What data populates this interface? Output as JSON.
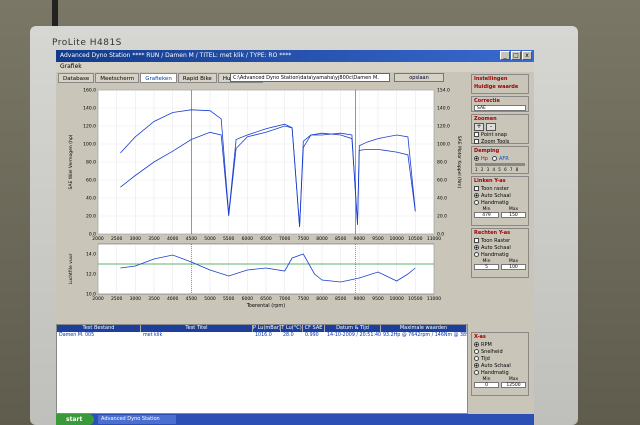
{
  "monitor": {
    "brand": "ProLite H481S"
  },
  "window": {
    "title": "Advanced Dyno Station  **** RUN / Damen M / TITEL: met klik / TYPE: RO ****",
    "btn_min": "_",
    "btn_max": "□",
    "btn_close": "x"
  },
  "menu": {
    "item": "Grafiek"
  },
  "tabs": [
    "Database",
    "Meetscherm",
    "Grafieken",
    "Rapid Bike",
    "Huidige map"
  ],
  "active_tab": "Grafieken",
  "path": "C:\\Advanced Dyno Station\\data\\yamaha\\yj800c\\Damen M.",
  "save_label": "opslaan",
  "top_chart": {
    "ylabel_left": "SAE Wiel Vermogen (hp)",
    "ylabel_right": "SAE Motor Koppel (Nm)",
    "y_left_ticks": [
      "0.0",
      "20.0",
      "40.0",
      "60.0",
      "80.0",
      "100.0",
      "120.0",
      "140.0",
      "160.0"
    ],
    "y_right_ticks": [
      "0.0",
      "20.0",
      "40.0",
      "60.0",
      "80.0",
      "100.0",
      "120.0",
      "140.0",
      "154.0"
    ],
    "x_ticks": [
      "2000",
      "2500",
      "3000",
      "3500",
      "4000",
      "4500",
      "5000",
      "5500",
      "6000",
      "6500",
      "7000",
      "7500",
      "8000",
      "8500",
      "9000",
      "9500",
      "10000",
      "10500",
      "11000"
    ],
    "xlim": [
      2000,
      11000
    ]
  },
  "bottom_chart": {
    "ylabel": "Luchtfile vuur",
    "xlabel": "Toerental (rpm)",
    "y_ticks": [
      "10.0",
      "12.0",
      "14.0"
    ],
    "x_ticks": [
      "2000",
      "2500",
      "3000",
      "3500",
      "4000",
      "4500",
      "5000",
      "5500",
      "6000",
      "6500",
      "7000",
      "7500",
      "8000",
      "8500",
      "9000",
      "9500",
      "10000",
      "10500",
      "11000"
    ],
    "reference_line": 13.0
  },
  "chart_data": [
    {
      "type": "line",
      "title": "",
      "xlabel": "",
      "ylabel": "SAE Wiel Vermogen (hp)",
      "xlim": [
        2000,
        11000
      ],
      "ylim": [
        0,
        160
      ],
      "series": [
        {
          "name": "power",
          "x": [
            2600,
            3000,
            3500,
            4000,
            4500,
            5000,
            5300,
            5500,
            5700,
            6000,
            6500,
            7000,
            7200,
            7400,
            7500,
            7700,
            8000,
            8500,
            8800,
            8950,
            9000,
            9200,
            9500,
            10000,
            10300,
            10500
          ],
          "y": [
            52,
            65,
            80,
            92,
            105,
            113,
            110,
            20,
            95,
            108,
            113,
            120,
            118,
            8,
            96,
            110,
            110,
            112,
            110,
            10,
            98,
            102,
            106,
            110,
            108,
            26
          ]
        },
        {
          "name": "torque",
          "x": [
            2600,
            3000,
            3500,
            4000,
            4500,
            5000,
            5300,
            5500,
            5700,
            6000,
            6500,
            7000,
            7200,
            7400,
            7500,
            7700,
            8000,
            8500,
            8800,
            8950,
            9000,
            9200,
            9500,
            10000,
            10300,
            10500
          ],
          "y": [
            90,
            108,
            125,
            135,
            138,
            137,
            128,
            22,
            105,
            110,
            117,
            122,
            118,
            8,
            103,
            110,
            112,
            110,
            106,
            12,
            93,
            94,
            94,
            91,
            88,
            25
          ]
        }
      ]
    },
    {
      "type": "line",
      "title": "",
      "xlabel": "Toerental (rpm)",
      "ylabel": "Luchtfile vuur",
      "xlim": [
        2000,
        11000
      ],
      "ylim": [
        10,
        15
      ],
      "series": [
        {
          "name": "afr",
          "x": [
            2600,
            3000,
            3500,
            4000,
            4500,
            5000,
            5500,
            6000,
            6500,
            7000,
            7200,
            7500,
            7800,
            8000,
            8500,
            9000,
            9500,
            10000,
            10300,
            10500
          ],
          "y": [
            12.6,
            12.8,
            13.5,
            13.9,
            13.2,
            12.4,
            11.8,
            12.4,
            12.6,
            12.3,
            13.6,
            14.0,
            12.0,
            11.4,
            11.2,
            11.6,
            12.2,
            11.3,
            12.0,
            12.6
          ]
        }
      ]
    }
  ],
  "table": {
    "headers": [
      "Test Bestand",
      "Test Titel",
      "P Lu(mBar)",
      "T Lu(°C)",
      "CF SAE",
      "Datum & Tijd",
      "Maximale waarden"
    ],
    "row": [
      "Damen M. 005",
      "met klik",
      "1016.0",
      "28.0",
      "0.990",
      "14-10-2009 / 20:51:40",
      "93.2Hp @ 7642rpm / 146Nm @ 3892rpm"
    ]
  },
  "panel": {
    "instellingen": "Instellingen",
    "huidige": "Huidige waarde",
    "correctie": "Correctie",
    "correctie_val": "SAE",
    "zoomen": "Zoomen",
    "zoom_plus": "+",
    "zoom_minus": "-",
    "point_snap": "Point snap",
    "zoom_tools": "Zoom Tools",
    "demping": "Demping",
    "hp": "Hp",
    "afr": "AFR",
    "damp_scale": "1 2 3 4 5 6 7 8",
    "links_head": "Linken Y-as",
    "links_opts": [
      "Toon raster",
      "Auto Schaal",
      "Handmatig"
    ],
    "links_min": "Min",
    "links_max": "Max",
    "links_min_val": "479",
    "links_max_val": "150",
    "rechts_head": "Rechten Y-as",
    "rechts_opts": [
      "Toon Raster",
      "Auto Schaal",
      "Handmatig"
    ],
    "rechts_min": "Min",
    "rechts_max": "Max",
    "rechts_min_val": "5",
    "rechts_max_val": "100",
    "x_head": "X-as",
    "x_opts": [
      "RPM",
      "Snelheid",
      "Tijd",
      "Auto Schaal",
      "Handmatig"
    ],
    "x_min": "Min",
    "x_max": "Max",
    "x_min_val": "0",
    "x_max_val": "12500"
  },
  "taskbar": {
    "start": "start",
    "item": "Advanced Dyno Station"
  }
}
